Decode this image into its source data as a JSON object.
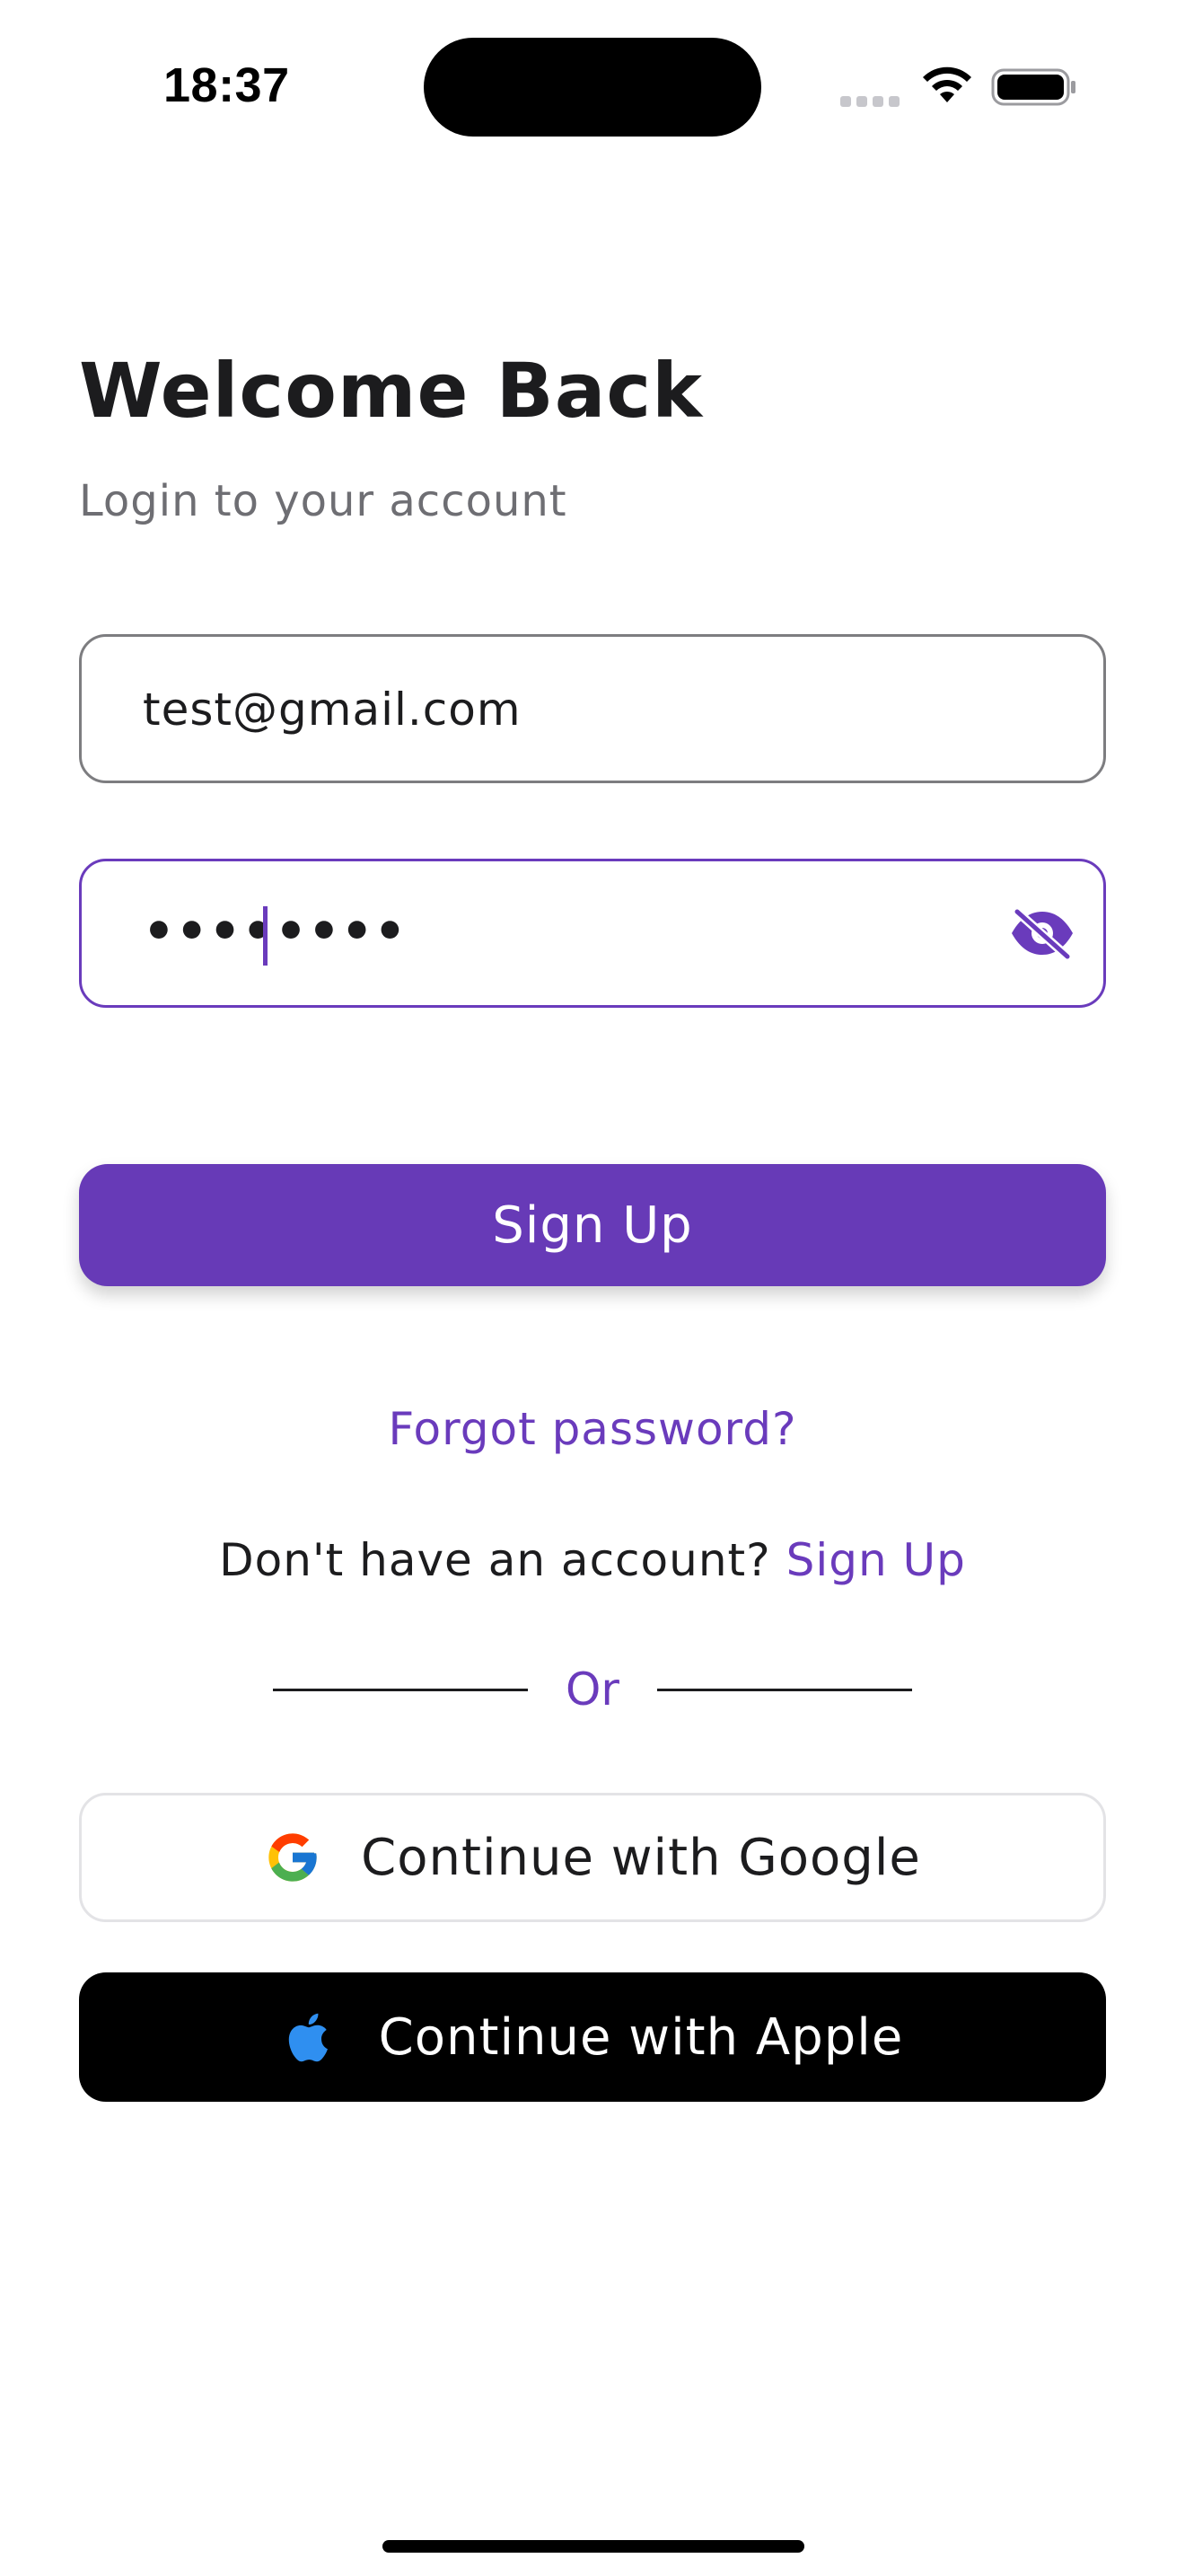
{
  "status_bar": {
    "time": "18:37",
    "icons": [
      "signal-icon",
      "wifi-icon",
      "battery-icon"
    ]
  },
  "header": {
    "title": "Welcome Back",
    "subtitle": "Login to your account"
  },
  "form": {
    "email_value": "test@gmail.com",
    "password_masked": "••••••••",
    "password_toggle_icon": "eye-off-icon"
  },
  "actions": {
    "primary_label": "Sign Up",
    "forgot_password": "Forgot password?",
    "no_account_text": "Don't have an account?",
    "signup_link": "Sign Up",
    "divider_text": "Or",
    "google_label": "Continue with Google",
    "apple_label": "Continue with Apple"
  },
  "colors": {
    "accent": "#673AB7",
    "text": "#1C1C1E",
    "muted": "#6E6E73",
    "apple_button": "#000000",
    "apple_logo": "#2F8FF0"
  }
}
